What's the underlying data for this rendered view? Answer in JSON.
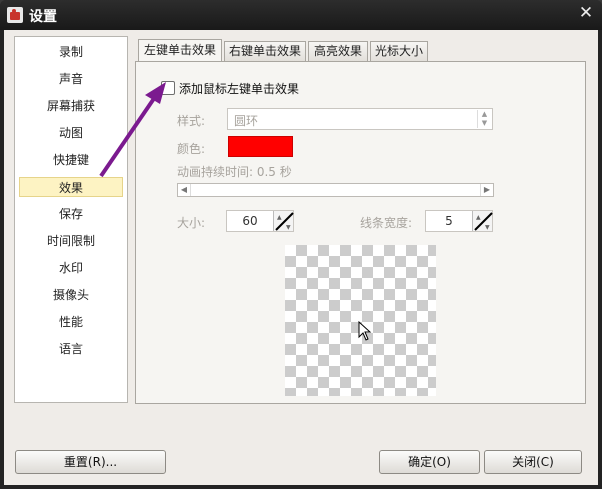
{
  "window": {
    "title": "设置"
  },
  "sidebar": {
    "items": [
      {
        "label": "录制"
      },
      {
        "label": "声音"
      },
      {
        "label": "屏幕捕获"
      },
      {
        "label": "动图"
      },
      {
        "label": "快捷键"
      },
      {
        "label": "效果"
      },
      {
        "label": "保存"
      },
      {
        "label": "时间限制"
      },
      {
        "label": "水印"
      },
      {
        "label": "摄像头"
      },
      {
        "label": "性能"
      },
      {
        "label": "语言"
      }
    ],
    "selected": "效果"
  },
  "tabs": [
    {
      "label": "左键单击效果"
    },
    {
      "label": "右键单击效果"
    },
    {
      "label": "高亮效果"
    },
    {
      "label": "光标大小"
    }
  ],
  "panel": {
    "checkbox_label": "添加鼠标左键单击效果",
    "checked": false,
    "style_label": "样式:",
    "style_value": "圆环",
    "color_label": "颜色:",
    "color_value": "#ff0000",
    "duration_label": "动画持续时间: 0.5 秒",
    "size_label": "大小:",
    "size_value": "60",
    "line_width_label": "线条宽度:",
    "line_width_value": "5"
  },
  "buttons": {
    "reset": "重置(R)...",
    "ok": "确定(O)",
    "close": "关闭(C)"
  },
  "colors": {
    "annotation_arrow": "#7b1a8f",
    "selected_bg": "#fdf3c3"
  }
}
